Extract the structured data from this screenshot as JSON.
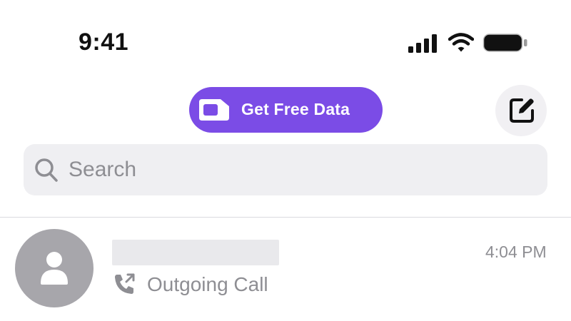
{
  "status_bar": {
    "time": "9:41",
    "icons": [
      "cellular-signal-icon",
      "wifi-icon",
      "battery-icon"
    ]
  },
  "header": {
    "promo_button": {
      "label": "Get Free Data",
      "icon": "sim-card-icon",
      "color": "#7b4ce6"
    },
    "compose_button": {
      "icon": "compose-icon"
    }
  },
  "search": {
    "placeholder": "Search",
    "value": ""
  },
  "conversations": [
    {
      "name": "",
      "status_icon": "outgoing-call-icon",
      "status_text": "Outgoing Call",
      "timestamp": "4:04 PM"
    }
  ],
  "colors": {
    "accent": "#7b4ce6",
    "secondary_text": "#8e8e93",
    "search_background": "#efeff2",
    "avatar_background": "#a7a6ab"
  }
}
